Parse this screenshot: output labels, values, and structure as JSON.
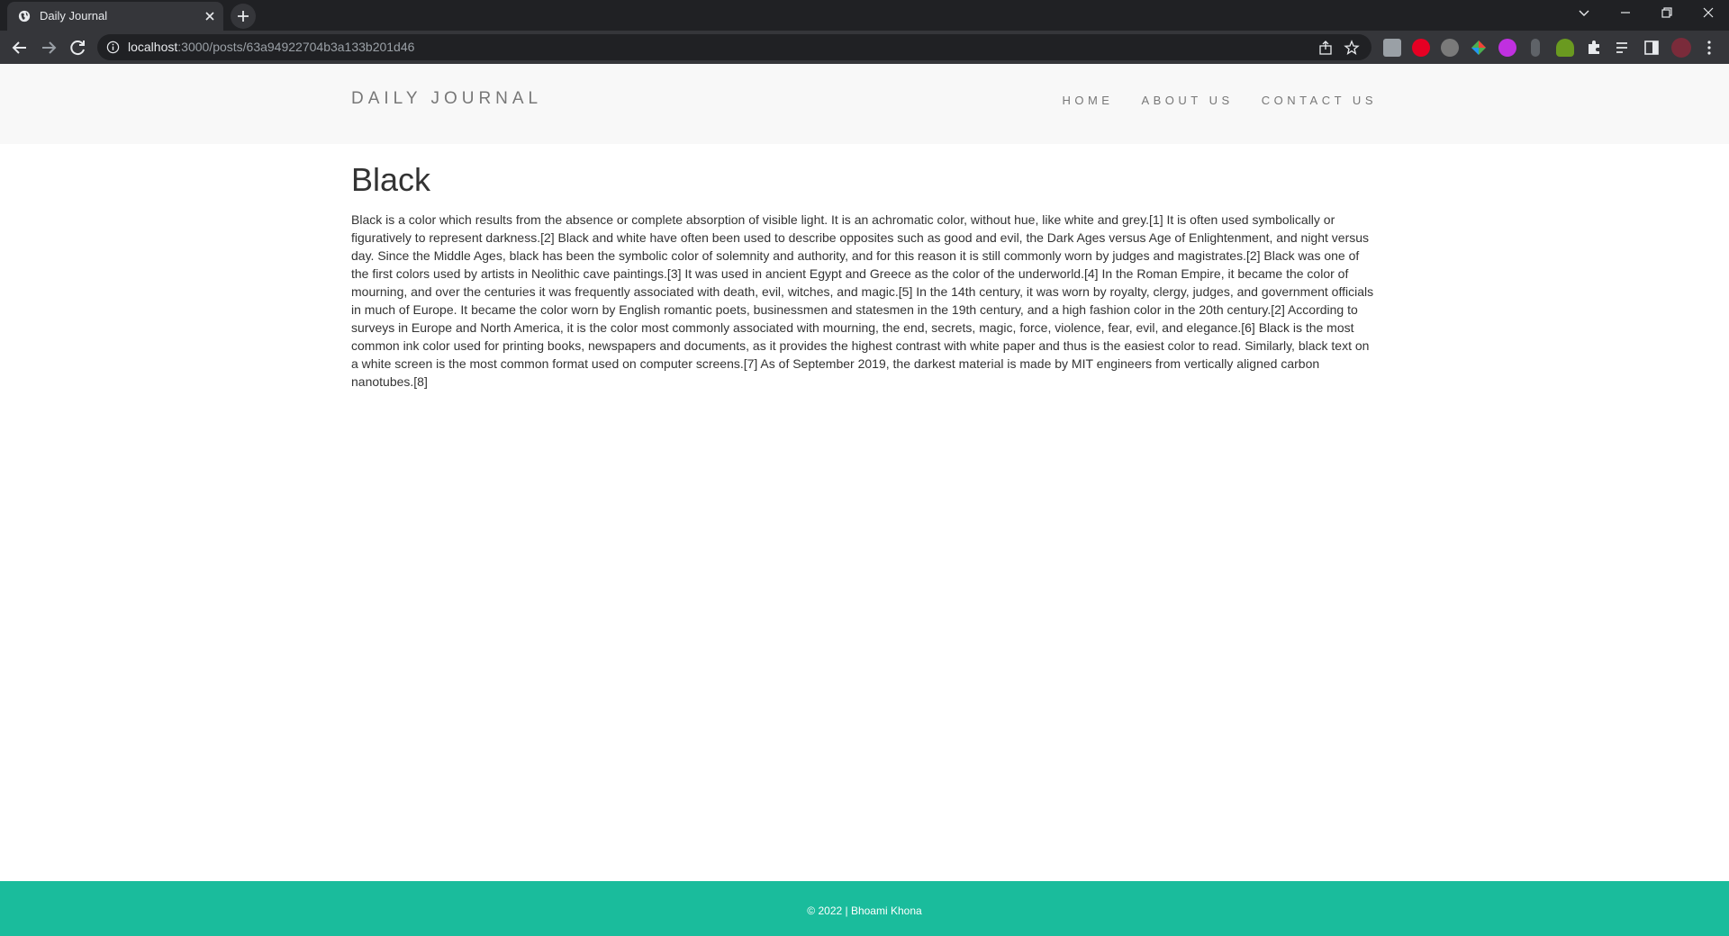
{
  "browser": {
    "tab_title": "Daily Journal",
    "url_host": "localhost",
    "url_path": ":3000/posts/63a94922704b3a133b201d46"
  },
  "site": {
    "brand": "DAILY JOURNAL",
    "nav": [
      {
        "label": "HOME"
      },
      {
        "label": "ABOUT US"
      },
      {
        "label": "CONTACT US"
      }
    ]
  },
  "post": {
    "title": "Black",
    "body": "Black is a color which results from the absence or complete absorption of visible light. It is an achromatic color, without hue, like white and grey.[1] It is often used symbolically or figuratively to represent darkness.[2] Black and white have often been used to describe opposites such as good and evil, the Dark Ages versus Age of Enlightenment, and night versus day. Since the Middle Ages, black has been the symbolic color of solemnity and authority, and for this reason it is still commonly worn by judges and magistrates.[2] Black was one of the first colors used by artists in Neolithic cave paintings.[3] It was used in ancient Egypt and Greece as the color of the underworld.[4] In the Roman Empire, it became the color of mourning, and over the centuries it was frequently associated with death, evil, witches, and magic.[5] In the 14th century, it was worn by royalty, clergy, judges, and government officials in much of Europe. It became the color worn by English romantic poets, businessmen and statesmen in the 19th century, and a high fashion color in the 20th century.[2] According to surveys in Europe and North America, it is the color most commonly associated with mourning, the end, secrets, magic, force, violence, fear, evil, and elegance.[6] Black is the most common ink color used for printing books, newspapers and documents, as it provides the highest contrast with white paper and thus is the easiest color to read. Similarly, black text on a white screen is the most common format used on computer screens.[7] As of September 2019, the darkest material is made by MIT engineers from vertically aligned carbon nanotubes.[8]"
  },
  "footer": {
    "text": "© 2022 | Bhoami Khona"
  },
  "colors": {
    "footer_bg": "#1abc9c",
    "header_bg": "#f8f8f8",
    "chrome_dark": "#202124",
    "chrome_toolbar": "#35363a"
  }
}
